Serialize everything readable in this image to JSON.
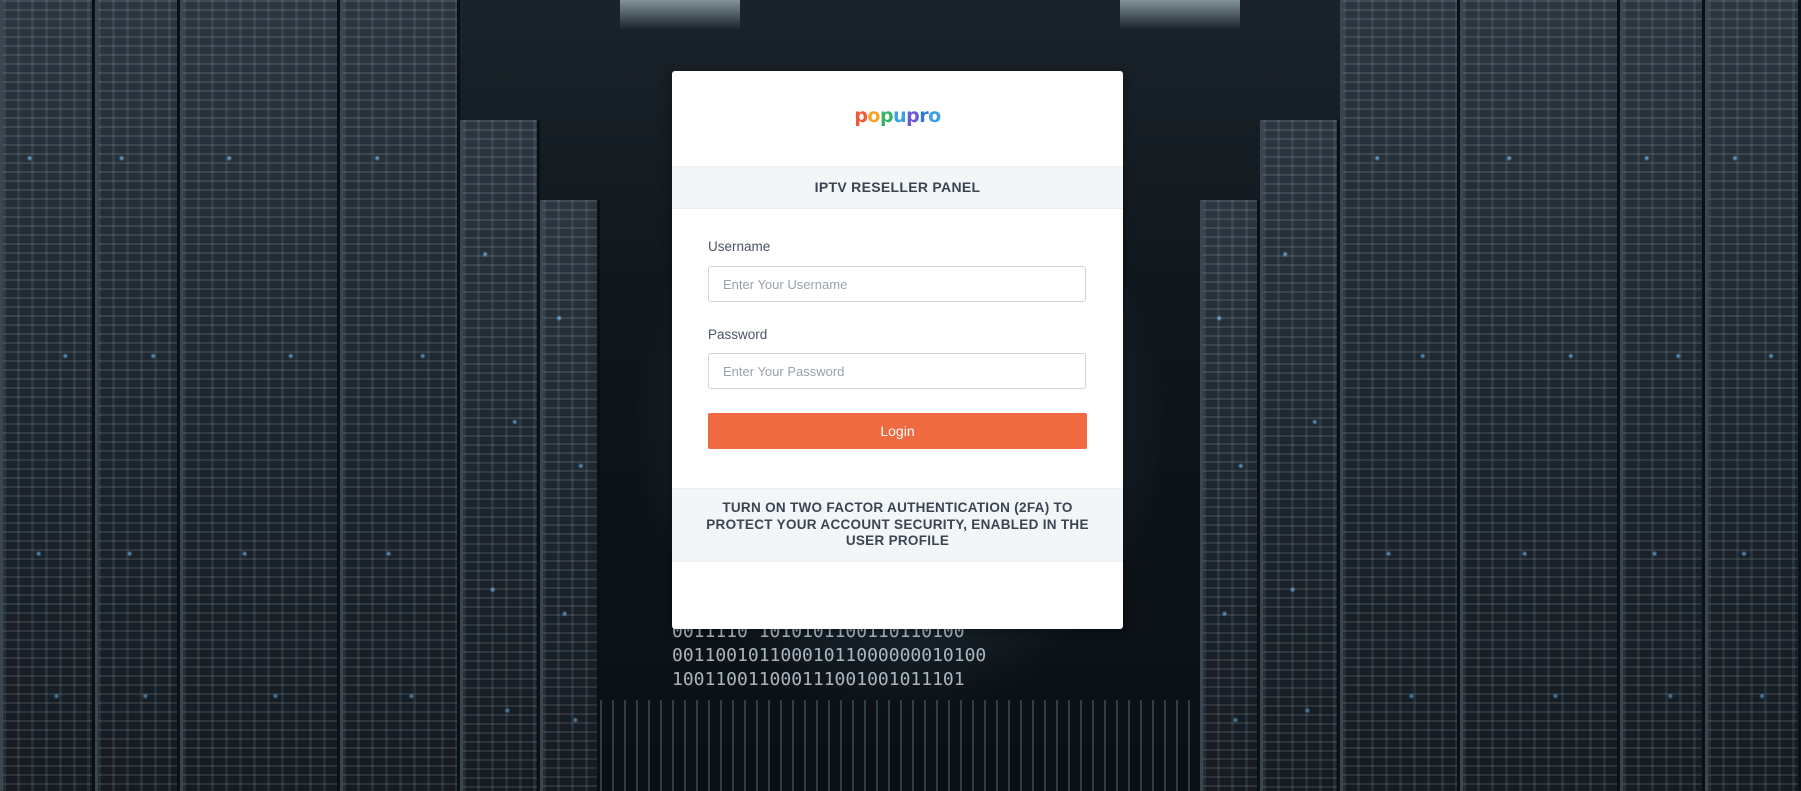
{
  "brand": {
    "logo_text": "popupro",
    "panel_title": "IPTV RESELLER PANEL"
  },
  "form": {
    "username_label": "Username",
    "username_placeholder": "Enter Your Username",
    "password_label": "Password",
    "password_placeholder": "Enter Your Password",
    "login_label": "Login"
  },
  "notice": {
    "text": "TURN ON TWO FACTOR AUTHENTICATION (2FA) TO PROTECT YOUR ACCOUNT SECURITY, ENABLED IN THE USER PROFILE"
  },
  "colors": {
    "accent": "#ef6a40",
    "panel_bg": "#f3f6f8",
    "text_dark": "#3b4452"
  }
}
